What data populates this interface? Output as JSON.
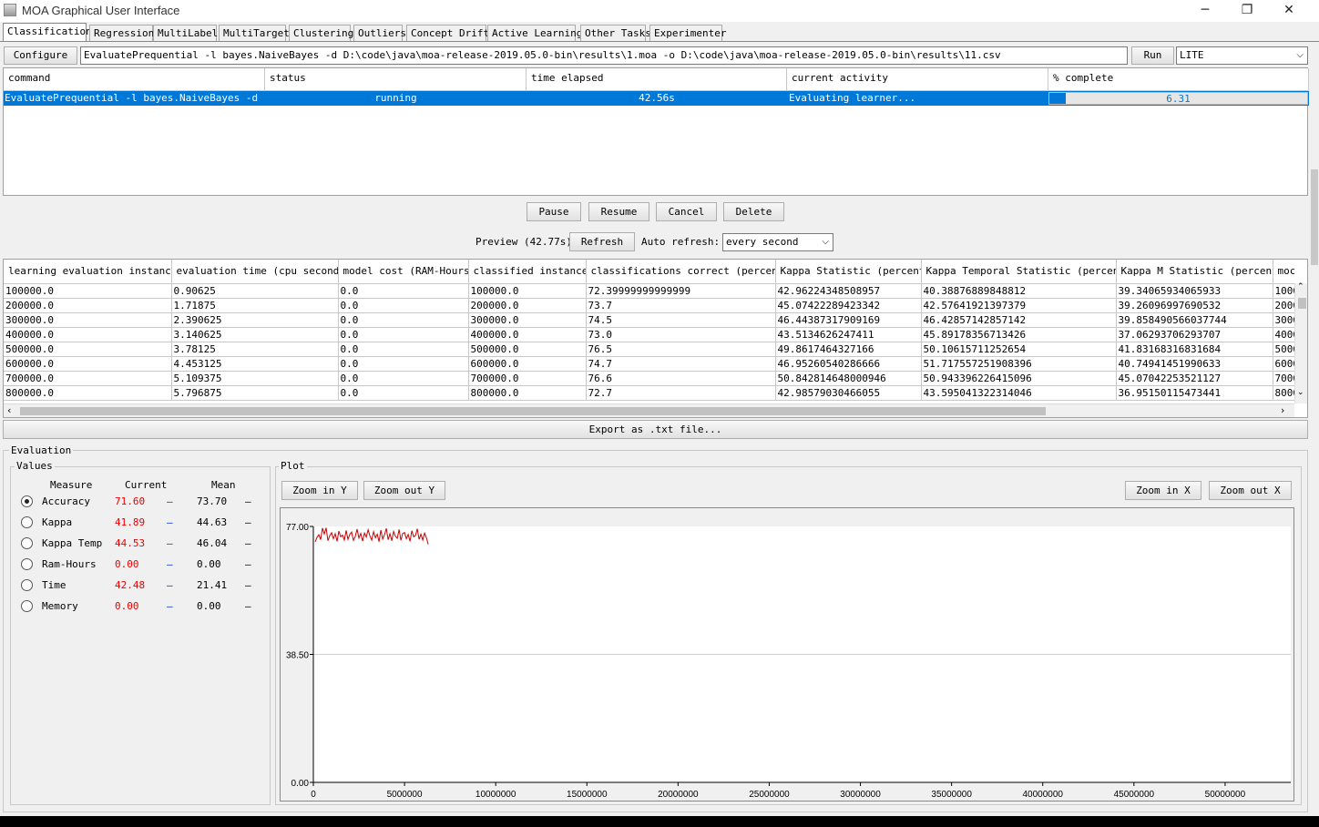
{
  "window": {
    "title": "MOA Graphical User Interface"
  },
  "tabs": [
    "Classification",
    "Regression",
    "MultiLabel",
    "MultiTarget",
    "Clustering",
    "Outliers",
    "Concept Drift",
    "Active Learning",
    "Other Tasks",
    "Experimenter"
  ],
  "toolbar": {
    "configure_label": "Configure",
    "command_value": "EvaluatePrequential -l bayes.NaiveBayes -d D:\\code\\java\\moa-release-2019.05.0-bin\\results\\1.moa -o D:\\code\\java\\moa-release-2019.05.0-bin\\results\\11.csv",
    "run_label": "Run",
    "mode_value": "LITE"
  },
  "tasks": {
    "headers": [
      "command",
      "status",
      "time elapsed",
      "current activity",
      "% complete"
    ],
    "row": {
      "command": "EvaluatePrequential -l bayes.NaiveBayes -d D...",
      "status": "running",
      "time": "42.56s",
      "activity": "Evaluating learner...",
      "percent": "6.31",
      "percent_value": 0.0631
    }
  },
  "task_buttons": {
    "pause": "Pause",
    "resume": "Resume",
    "cancel": "Cancel",
    "delete": "Delete"
  },
  "preview": {
    "label": "Preview (42.77s)",
    "refresh": "Refresh",
    "auto_label": "Auto refresh:",
    "auto_value": "every second"
  },
  "results": {
    "headers": [
      "learning evaluation instances",
      "evaluation time (cpu seconds)",
      "model cost (RAM-Hours)",
      "classified instances",
      "classifications correct (percent)",
      "Kappa Statistic (percent)",
      "Kappa Temporal Statistic (percent)",
      "Kappa M Statistic (percent)",
      "moc"
    ],
    "rows": [
      [
        "100000.0",
        "0.90625",
        "0.0",
        "100000.0",
        "72.39999999999999",
        "42.96224348508957",
        "40.38876889848812",
        "39.34065934065933",
        "1000"
      ],
      [
        "200000.0",
        "1.71875",
        "0.0",
        "200000.0",
        "73.7",
        "45.07422289423342",
        "42.57641921397379",
        "39.26096997690532",
        "2000"
      ],
      [
        "300000.0",
        "2.390625",
        "0.0",
        "300000.0",
        "74.5",
        "46.44387317909169",
        "46.42857142857142",
        "39.858490566037744",
        "3000"
      ],
      [
        "400000.0",
        "3.140625",
        "0.0",
        "400000.0",
        "73.0",
        "43.5134626247411",
        "45.89178356713426",
        "37.06293706293707",
        "4000"
      ],
      [
        "500000.0",
        "3.78125",
        "0.0",
        "500000.0",
        "76.5",
        "49.8617464327166",
        "50.10615711252654",
        "41.83168316831684",
        "5000"
      ],
      [
        "600000.0",
        "4.453125",
        "0.0",
        "600000.0",
        "74.7",
        "46.95260540286666",
        "51.717557251908396",
        "40.74941451990633",
        "6000"
      ],
      [
        "700000.0",
        "5.109375",
        "0.0",
        "700000.0",
        "76.6",
        "50.842814648000946",
        "50.943396226415096",
        "45.07042253521127",
        "7000"
      ],
      [
        "800000.0",
        "5.796875",
        "0.0",
        "800000.0",
        "72.7",
        "42.98579030466055",
        "43.595041322314046",
        "36.95150115473441",
        "8000"
      ]
    ],
    "export_label": "Export as .txt file..."
  },
  "evaluation": {
    "title": "Evaluation",
    "values_title": "Values",
    "col_measure": "Measure",
    "col_current": "Current",
    "col_mean": "Mean",
    "measures": [
      {
        "name": "Accuracy",
        "current": "71.60",
        "mean": "73.70",
        "selected": true
      },
      {
        "name": "Kappa",
        "current": "41.89",
        "mean": "44.63",
        "selected": false
      },
      {
        "name": "Kappa Temp",
        "current": "44.53",
        "mean": "46.04",
        "selected": false
      },
      {
        "name": "Ram-Hours",
        "current": "0.00",
        "mean": "0.00",
        "selected": false
      },
      {
        "name": "Time",
        "current": "42.48",
        "mean": "21.41",
        "selected": false
      },
      {
        "name": "Memory",
        "current": "0.00",
        "mean": "0.00",
        "selected": false
      }
    ],
    "dash": "–"
  },
  "plot": {
    "title": "Plot",
    "zoom_in_y": "Zoom in Y",
    "zoom_out_y": "Zoom out Y",
    "zoom_in_x": "Zoom in X",
    "zoom_out_x": "Zoom out X"
  },
  "chart_data": {
    "type": "line",
    "title": "",
    "xlabel": "",
    "ylabel": "",
    "ylim": [
      0,
      77
    ],
    "xlim": [
      0,
      53600000
    ],
    "y_ticks": [
      "77.00",
      "38.50",
      "0.00"
    ],
    "x_ticks": [
      "0",
      "5000000",
      "10000000",
      "15000000",
      "20000000",
      "25000000",
      "30000000",
      "35000000",
      "40000000",
      "45000000",
      "50000000"
    ],
    "series": [
      {
        "color": "#cc0000",
        "x": [
          100000,
          200000,
          300000,
          400000,
          500000,
          600000,
          700000,
          800000,
          900000,
          1000000,
          1100000,
          1200000,
          1300000,
          1400000,
          1500000,
          1600000,
          1700000,
          1800000,
          1900000,
          2000000,
          2100000,
          2200000,
          2300000,
          2400000,
          2500000,
          2600000,
          2700000,
          2800000,
          2900000,
          3000000,
          3100000,
          3200000,
          3300000,
          3400000,
          3500000,
          3600000,
          3700000,
          3800000,
          3900000,
          4000000,
          4100000,
          4200000,
          4300000,
          4400000,
          4500000,
          4600000,
          4700000,
          4800000,
          4900000,
          5000000,
          5100000,
          5200000,
          5300000,
          5400000,
          5500000,
          5600000,
          5700000,
          5800000,
          5900000,
          6000000,
          6100000,
          6200000,
          6300000
        ],
        "y": [
          72.4,
          73.7,
          74.5,
          73.0,
          76.5,
          74.7,
          76.6,
          72.7,
          74.2,
          75.1,
          73.3,
          74.8,
          72.5,
          75.6,
          73.9,
          74.4,
          72.9,
          75.8,
          73.1,
          74.6,
          75.3,
          72.8,
          74.0,
          76.2,
          73.5,
          74.9,
          72.6,
          75.0,
          73.8,
          76.0,
          74.1,
          72.9,
          75.4,
          73.6,
          74.7,
          72.4,
          75.9,
          73.2,
          74.5,
          76.4,
          73.0,
          74.8,
          72.7,
          75.5,
          74.0,
          73.4,
          76.1,
          72.8,
          74.9,
          75.2,
          73.3,
          74.6,
          72.5,
          75.7,
          73.9,
          74.3,
          76.3,
          73.1,
          74.7,
          72.9,
          75.0,
          73.6,
          71.6
        ]
      }
    ]
  }
}
